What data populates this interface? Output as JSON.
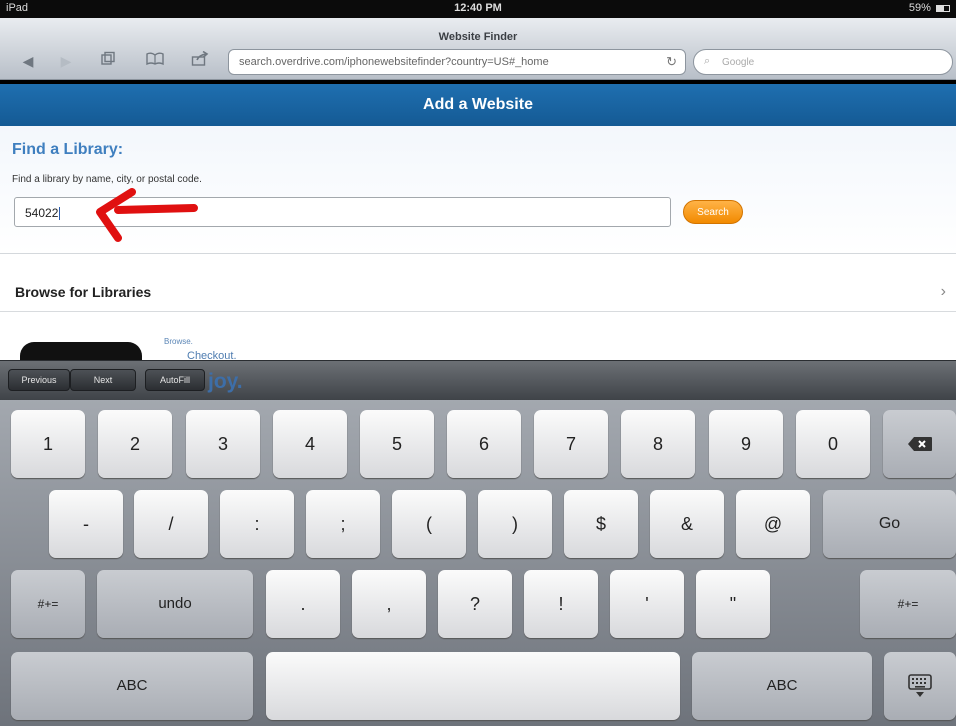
{
  "status_bar": {
    "device": "iPad",
    "time": "12:40 PM",
    "battery": "59%",
    "battery_level": 0.59
  },
  "browser": {
    "page_title": "Website Finder",
    "url": "search.overdrive.com/iphonewebsitefinder?country=US#_home",
    "search_placeholder": "Google",
    "nav_icons": [
      "back-arrow-icon",
      "forward-arrow-icon",
      "tabs-icon",
      "bookmarks-icon",
      "share-icon",
      "reload-icon"
    ]
  },
  "header": {
    "title": "Add a Website"
  },
  "find": {
    "heading": "Find a Library:",
    "description": "Find a library by name, city, or postal code.",
    "input_value": "54022",
    "search_button": "Search"
  },
  "browse": {
    "label": "Browse for Libraries",
    "chevron": "›"
  },
  "promo": {
    "line1": "Browse.",
    "line2": "Checkout.",
    "line3": "joy."
  },
  "accessory": {
    "previous": "Previous",
    "next": "Next",
    "autofill": "AutoFill"
  },
  "keyboard": {
    "row1": [
      "1",
      "2",
      "3",
      "4",
      "5",
      "6",
      "7",
      "8",
      "9",
      "0"
    ],
    "row2": [
      "-",
      "/",
      ":",
      ";",
      "(",
      ")",
      "$",
      "&",
      "@"
    ],
    "go": "Go",
    "shift_label": "#+=",
    "undo": "undo",
    "row3": [
      ".",
      ",",
      "?",
      "!",
      "'",
      "\""
    ],
    "abc": "ABC",
    "hide_icon": "keyboard-hide-icon",
    "delete_icon": "backspace-icon"
  },
  "colors": {
    "header_blue": "#1a66a6",
    "search_orange": "#f28a00",
    "annotation_red": "#e01010"
  }
}
